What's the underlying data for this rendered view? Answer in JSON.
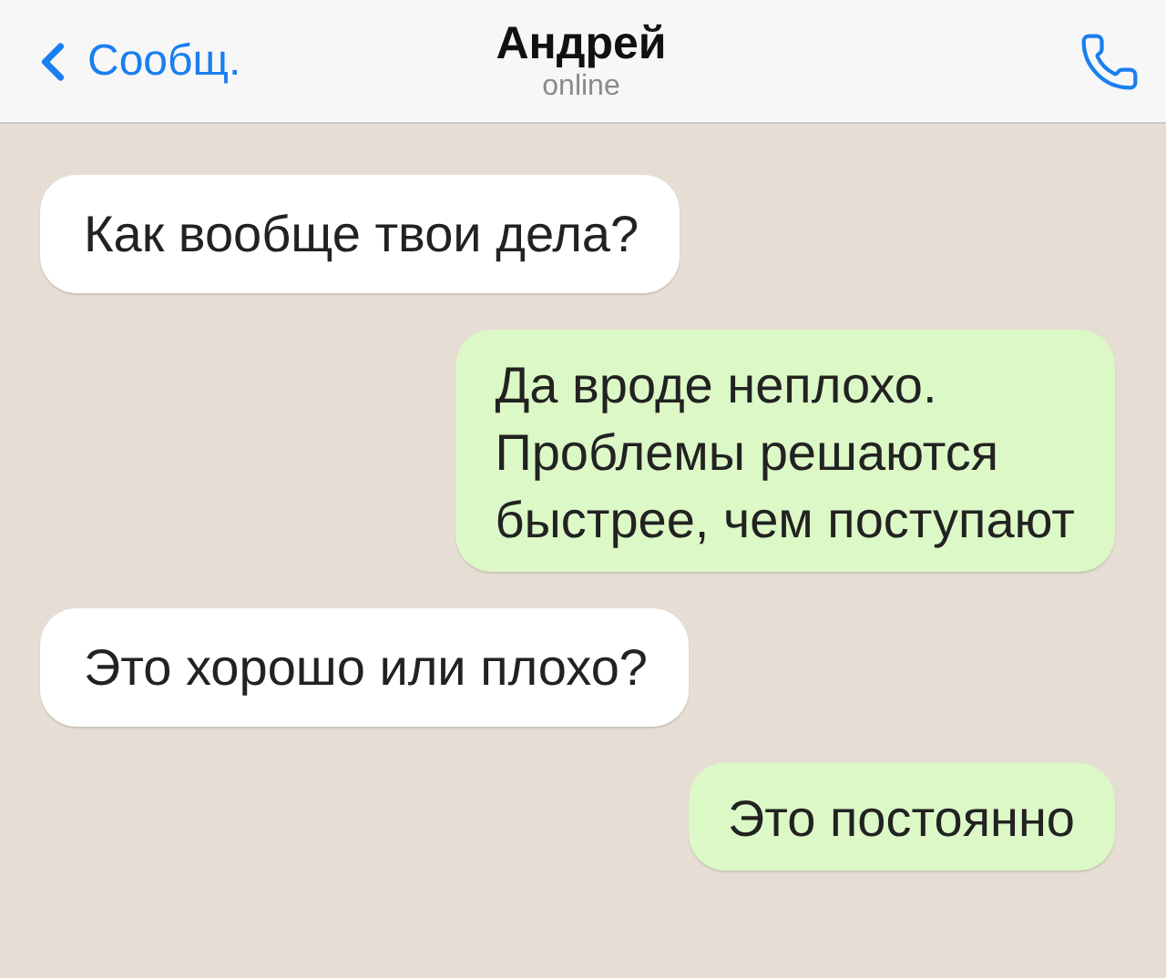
{
  "header": {
    "back_label": "Сообщ.",
    "contact_name": "Андрей",
    "status": "online"
  },
  "messages": [
    {
      "kind": "incoming",
      "text": "Как вообще твои дела?"
    },
    {
      "kind": "outgoing",
      "text": "Да вроде неплохо.\nПроблемы решаются\nбыстрее, чем поступают"
    },
    {
      "kind": "incoming",
      "text": "Это хорошо или плохо?"
    },
    {
      "kind": "outgoing",
      "text": "Это постоянно"
    }
  ]
}
